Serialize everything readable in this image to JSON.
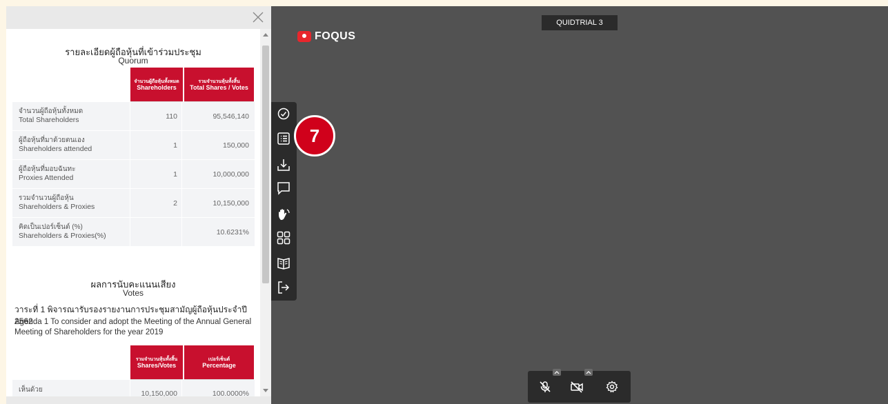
{
  "quorum": {
    "title_th": "รายละเอียดผู้ถือหุ้นที่เข้าร่วมประชุม",
    "title_en": "Quorum",
    "col1_th": "จำนวนผู้ถือหุ้นทั้งหมด",
    "col1_en": "Shareholders",
    "col2_th": "รวมจำนวนหุ้นทั้งสิ้น",
    "col2_en": "Total Shares / Votes",
    "rows": [
      {
        "th": "จำนวนผู้ถือหุ้นทั้งหมด",
        "en": "Total Shareholders",
        "v1": "110",
        "v2": "95,546,140"
      },
      {
        "th": "ผู้ถือหุ้นที่มาด้วยตนเอง",
        "en": "Shareholders attended",
        "v1": "1",
        "v2": "150,000"
      },
      {
        "th": "ผู้ถือหุ้นที่มอบฉันทะ",
        "en": "Proxies Attended",
        "v1": "1",
        "v2": "10,000,000"
      },
      {
        "th": "รวมจำนวนผู้ถือหุ้น",
        "en": "Shareholders & Proxies",
        "v1": "2",
        "v2": "10,150,000"
      },
      {
        "th": "คิดเป็นเปอร์เซ็นต์ (%)",
        "en": "Shareholders & Proxies(%)",
        "v1": "",
        "v2": "10.6231%"
      }
    ]
  },
  "votes": {
    "title_th": "ผลการนับคะแนนเสียง",
    "title_en": "Votes",
    "agenda_th": "วาระที่ 1 พิจารณารับรองรายงานการประชุมสามัญผู้ถือหุ้นประจำปี 2562",
    "agenda_en": "Agenda 1 To consider and adopt the Meeting of the Annual General Meeting of Shareholders for the year 2019",
    "col1_th": "รวมจำนวนหุ้นทั้งสิ้น",
    "col1_en": "Shares/Votes",
    "col2_th": "เปอร์เซ็นต์",
    "col2_en": "Percentage",
    "rows": [
      {
        "th": "เห็นด้วย",
        "v1": "10,150,000",
        "v2": "100.0000%"
      }
    ]
  },
  "room_label": "QUIDTRIAL 3",
  "logo_text": "FOQUS",
  "badge_number": "7",
  "colors": {
    "accent_red": "#c8102e",
    "stage_bg": "#525252",
    "toolbar_bg": "#2b2b2b",
    "badge_red": "#d0011b"
  },
  "toolbar_icons": [
    "check-circle-icon",
    "list-icon",
    "download-icon",
    "chat-icon",
    "raise-hand-icon",
    "grid-icon",
    "book-icon",
    "logout-icon"
  ],
  "control_icons": [
    "mic-muted-icon",
    "camera-off-icon",
    "settings-icon"
  ]
}
